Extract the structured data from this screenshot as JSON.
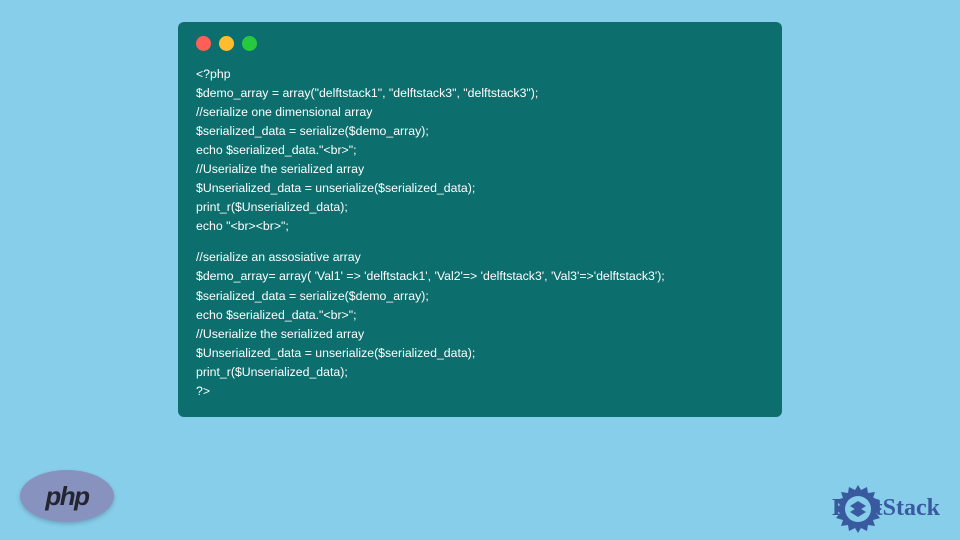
{
  "code": {
    "block1": [
      "<?php",
      "$demo_array = array(\"delftstack1\", \"delftstack3\", \"delftstack3\");",
      "//serialize one dimensional array",
      "$serialized_data = serialize($demo_array);",
      "echo $serialized_data.\"<br>\";",
      "//Userialize the serialized array",
      "$Unserialized_data = unserialize($serialized_data);",
      "print_r($Unserialized_data);",
      "echo \"<br><br>\";"
    ],
    "block2": [
      "//serialize an assosiative array",
      "$demo_array= array( 'Val1' => 'delftstack1', 'Val2'=> 'delftstack3', 'Val3'=>'delftstack3');",
      "$serialized_data = serialize($demo_array);",
      "echo $serialized_data.\"<br>\";",
      "//Userialize the serialized array",
      "$Unserialized_data = unserialize($serialized_data);",
      "print_r($Unserialized_data);",
      "?>"
    ]
  },
  "phpLogoText": "php",
  "delftText": "DelftStack"
}
